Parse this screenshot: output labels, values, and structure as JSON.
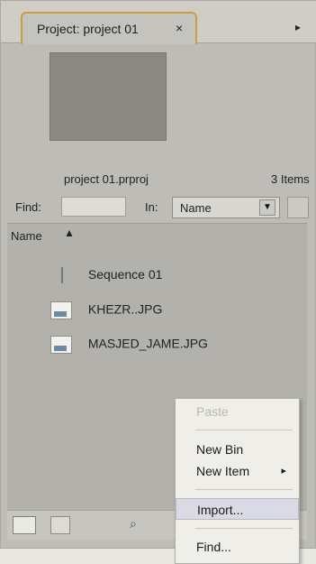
{
  "panel": {
    "tab_title": "Project: project 01",
    "tab_close": "×",
    "menu_button": "▸",
    "project_file": "project 01.prproj",
    "item_count": "3 Items"
  },
  "search": {
    "find_label": "Find:",
    "find_value": "",
    "in_label": "In:",
    "in_value": "Name",
    "dropdown_arrow": "▼"
  },
  "list": {
    "column_name": "Name",
    "sort_glyph": "▲",
    "items": [
      {
        "label": "Sequence 01",
        "icon": "sequence-icon"
      },
      {
        "label": "KHEZR..JPG",
        "icon": "image-file-icon"
      },
      {
        "label": "MASJED_JAME.JPG",
        "icon": "image-file-icon"
      }
    ]
  },
  "bottom": {
    "list_view_icon": "list-view-icon",
    "icon_view_icon": "icon-view-icon",
    "find_glyph": "⌕"
  },
  "context_menu": {
    "paste": "Paste",
    "new_bin": "New Bin",
    "new_item": "New Item",
    "new_item_arrow": "▸",
    "import": "Import...",
    "find": "Find..."
  }
}
